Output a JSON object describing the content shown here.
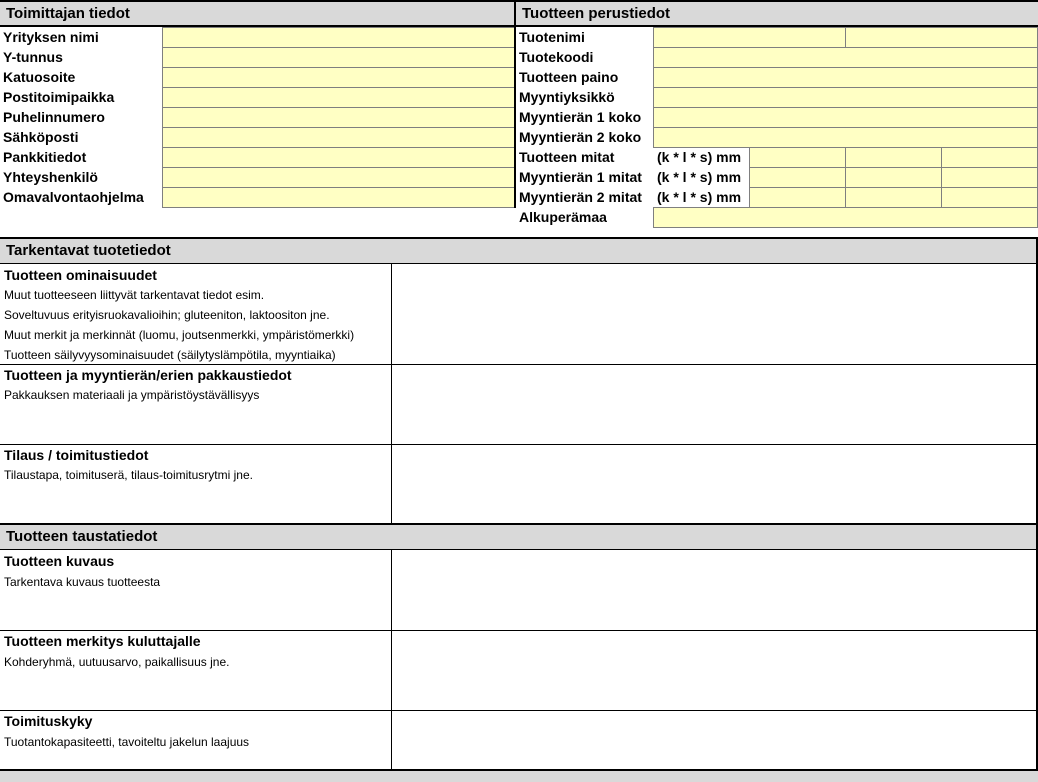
{
  "supplier": {
    "header": "Toimittajan tiedot",
    "fields": [
      "Yrityksen nimi",
      "Y-tunnus",
      "Katuosoite",
      "Postitoimipaikka",
      "Puhelinnumero",
      "Sähköposti",
      "Pankkitiedot",
      "Yhteyshenkilö",
      "Omavalvontaohjelma"
    ]
  },
  "product_basic": {
    "header": "Tuotteen perustiedot",
    "fields": [
      "Tuotenimi",
      "Tuotekoodi",
      "Tuotteen paino",
      "Myyntiyksikkö",
      "Myyntierän 1 koko",
      "Myyntierän 2 koko",
      "Tuotteen mitat",
      "Myyntierän 1 mitat",
      "Myyntierän 2 mitat",
      "Alkuperämaa"
    ],
    "dimension_unit": "(k * l * s) mm"
  },
  "detailed": {
    "header": "Tarkentavat tuotetiedot",
    "sections": [
      {
        "title": "Tuotteen ominaisuudet",
        "lines": [
          "Muut tuotteeseen liittyvät tarkentavat tiedot esim.",
          "Soveltuvuus erityisruokavalioihin; gluteeniton, laktoositon jne.",
          "Muut merkit ja merkinnät (luomu, joutsenmerkki, ympäristömerkki)",
          "Tuotteen säilyvyysominaisuudet (säilytyslämpötila, myyntiaika)"
        ]
      },
      {
        "title": "Tuotteen ja myyntierän/erien pakkaustiedot",
        "lines": [
          "Pakkauksen materiaali ja  ympäristöystävällisyys"
        ]
      },
      {
        "title": "Tilaus / toimitustiedot",
        "lines": [
          "Tilaustapa, toimituserä, tilaus-toimitusrytmi jne."
        ]
      }
    ]
  },
  "background": {
    "header": "Tuotteen taustatiedot",
    "sections": [
      {
        "title": "Tuotteen kuvaus",
        "lines": [
          "Tarkentava kuvaus tuotteesta"
        ]
      },
      {
        "title": "Tuotteen merkitys kuluttajalle",
        "lines": [
          "Kohderyhmä, uutuusarvo, paikallisuus jne."
        ]
      },
      {
        "title": "Toimituskyky",
        "lines": [
          "Tuotantokapasiteetti, tavoiteltu jakelun laajuus"
        ]
      }
    ]
  }
}
